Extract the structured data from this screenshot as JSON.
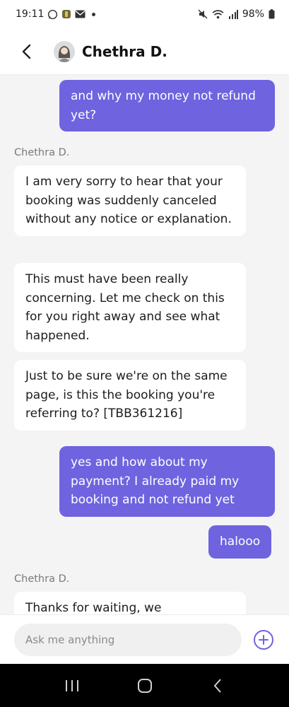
{
  "status_bar": {
    "time": "19:11",
    "battery": "98%",
    "icons": [
      "whatsapp-icon",
      "app-icon",
      "mail-icon",
      "notification-dot",
      "mute-icon",
      "wifi-icon",
      "signal-icon",
      "battery-icon"
    ]
  },
  "header": {
    "contact_name": "Chethra D.",
    "back_icon": "chevron-left-icon",
    "avatar_icon": "avatar"
  },
  "messages": [
    {
      "from": "user",
      "text": "and why my money not refund yet?"
    },
    {
      "from": "agent",
      "sender": "Chethra D."
    },
    {
      "from": "agent",
      "text": "I am very  sorry to hear that your booking was suddenly canceled without any notice or explanation."
    },
    {
      "from": "agent",
      "text": "This must have been really concerning. Let me check on this for you right away and see what happened."
    },
    {
      "from": "agent",
      "text": "Just to be sure we're on the same page, is this the booking you're referring to? [TBB361216]"
    },
    {
      "from": "user",
      "text": "yes and how about my payment? I already paid my booking and not refund yet"
    },
    {
      "from": "user",
      "text": "halooo"
    },
    {
      "from": "agent",
      "sender": "Chethra D."
    },
    {
      "from": "agent",
      "text": "Thanks for waiting, we"
    }
  ],
  "composer": {
    "placeholder": "Ask me anything",
    "add_icon": "plus-circle-icon",
    "accent": "#6f63df"
  },
  "nav_bar": {
    "icons": [
      "recent-apps-icon",
      "home-icon",
      "back-icon"
    ]
  },
  "colors": {
    "user_bubble": "#6f63df",
    "agent_bubble": "#ffffff",
    "chat_background": "#f4f4f5"
  }
}
